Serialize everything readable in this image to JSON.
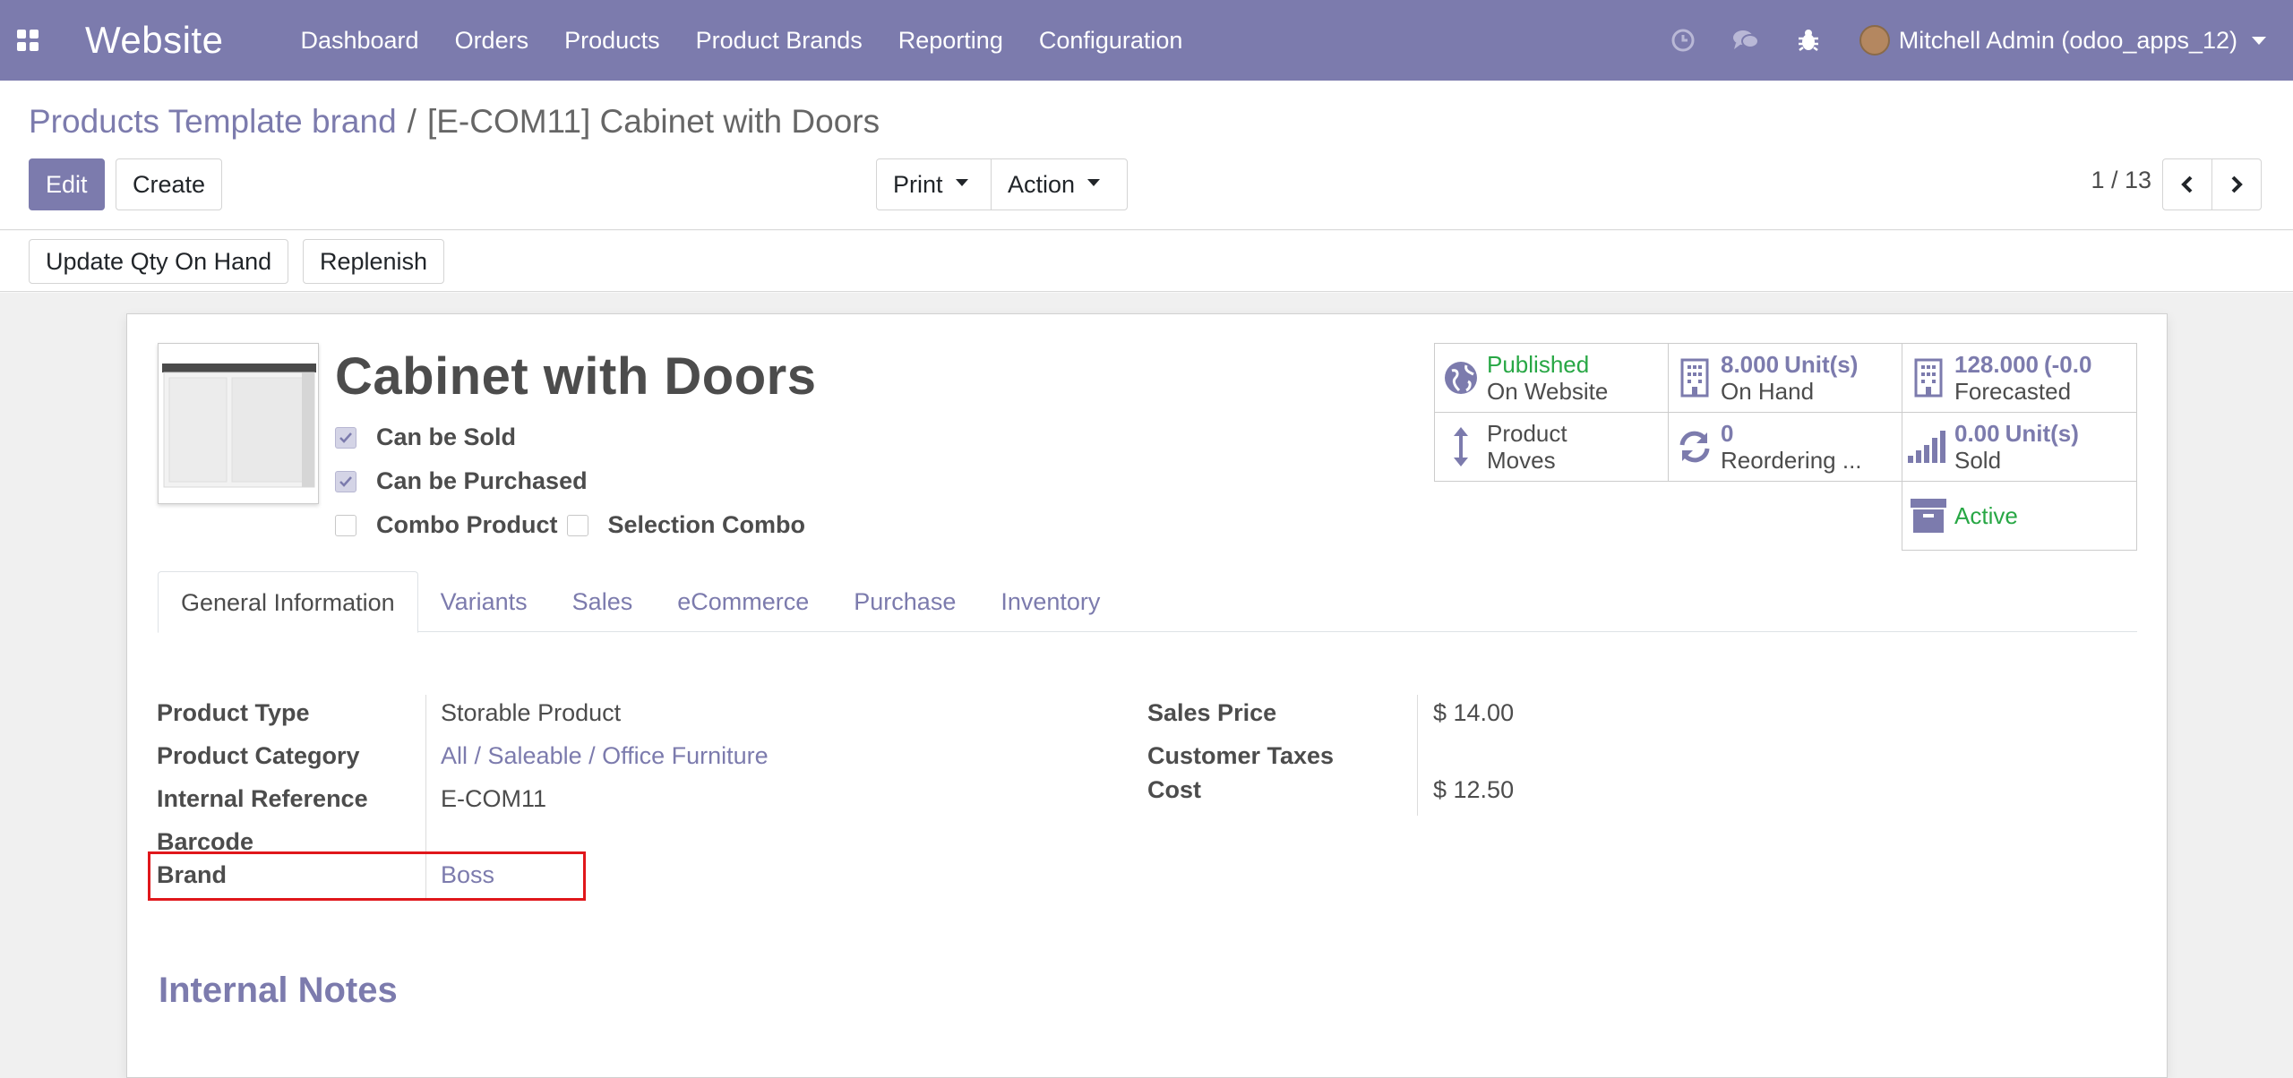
{
  "navbar": {
    "app_name": "Website",
    "menu": [
      "Dashboard",
      "Orders",
      "Products",
      "Product Brands",
      "Reporting",
      "Configuration"
    ],
    "user": "Mitchell Admin (odoo_apps_12)",
    "icons": [
      "clock-icon",
      "chat-icon",
      "bug-icon"
    ]
  },
  "breadcrumb": {
    "parent": "Products Template brand",
    "separator": "/",
    "current": "[E-COM11] Cabinet with Doors"
  },
  "toolbar": {
    "edit": "Edit",
    "create": "Create",
    "print": "Print",
    "action": "Action",
    "pager": "1 / 13"
  },
  "statusbar": {
    "update_qty": "Update Qty On Hand",
    "replenish": "Replenish"
  },
  "product": {
    "name": "Cabinet with Doors",
    "can_be_sold": "Can be Sold",
    "can_be_purchased": "Can be Purchased",
    "combo_product": "Combo Product",
    "selection_combo": "Selection Combo"
  },
  "smart_buttons": {
    "published": {
      "line1": "Published",
      "line2": "On Website"
    },
    "on_hand": {
      "value": "8.000",
      "unit": "Unit(s)",
      "label": "On Hand"
    },
    "forecasted": {
      "value": "128.000",
      "unit": "(-0.0",
      "label": "Forecasted"
    },
    "moves": {
      "line1": "Product",
      "line2": "Moves"
    },
    "reordering": {
      "value": "0",
      "label": "Reordering ..."
    },
    "sold": {
      "value": "0.00",
      "unit": "Unit(s)",
      "label": "Sold"
    },
    "active": {
      "label": "Active"
    }
  },
  "tabs": [
    "General Information",
    "Variants",
    "Sales",
    "eCommerce",
    "Purchase",
    "Inventory"
  ],
  "fields_left": {
    "product_type": {
      "label": "Product Type",
      "value": "Storable Product"
    },
    "product_category": {
      "label": "Product Category",
      "value": "All / Saleable / Office Furniture"
    },
    "internal_reference": {
      "label": "Internal Reference",
      "value": "E-COM11"
    },
    "barcode": {
      "label": "Barcode",
      "value": ""
    },
    "brand": {
      "label": "Brand",
      "value": "Boss"
    }
  },
  "fields_right": {
    "sales_price": {
      "label": "Sales Price",
      "value": "$ 14.00"
    },
    "customer_taxes": {
      "label": "Customer Taxes",
      "value": ""
    },
    "cost": {
      "label": "Cost",
      "value": "$ 12.50"
    }
  },
  "section": {
    "internal_notes": "Internal Notes"
  },
  "colors": {
    "brand": "#7c7bad",
    "active_green": "#28a745",
    "highlight": "#e0171b"
  }
}
